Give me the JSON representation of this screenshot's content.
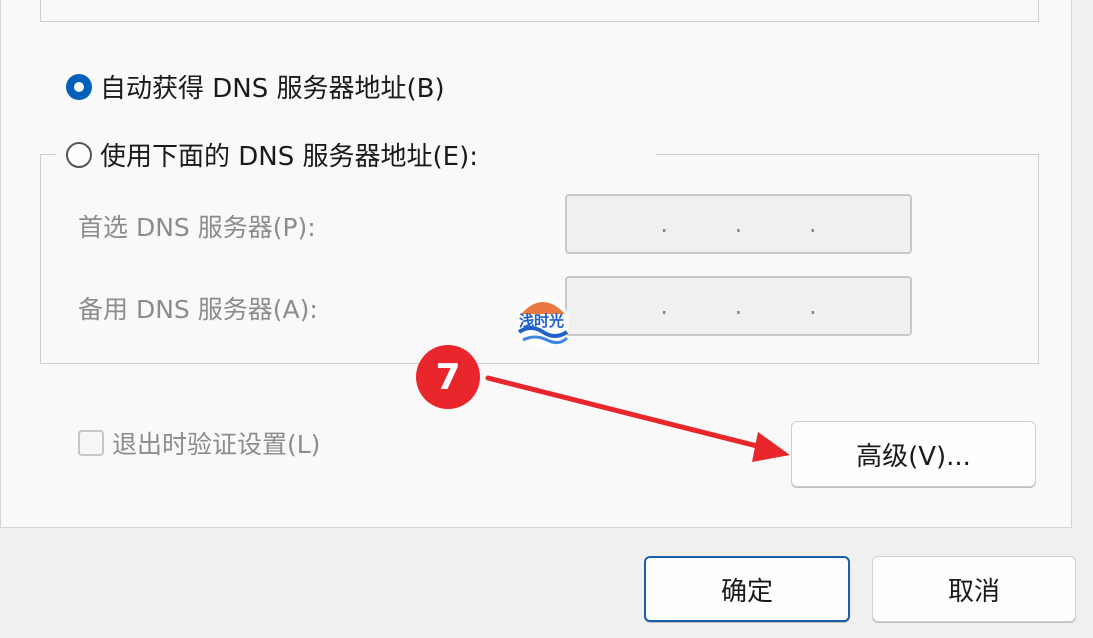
{
  "dns": {
    "auto_label": "自动获得 DNS 服务器地址(B)",
    "manual_label": "使用下面的 DNS 服务器地址(E):",
    "preferred_label": "首选 DNS 服务器(P):",
    "alternate_label": "备用 DNS 服务器(A):",
    "ip_dot": "."
  },
  "validate_label": "退出时验证设置(L)",
  "buttons": {
    "advanced": "高级(V)...",
    "ok": "确定",
    "cancel": "取消"
  },
  "annotation": {
    "step_number": "7"
  },
  "watermark": {
    "text": "浅时光"
  },
  "colors": {
    "accent": "#005fb8",
    "badge": "#e8262b"
  }
}
